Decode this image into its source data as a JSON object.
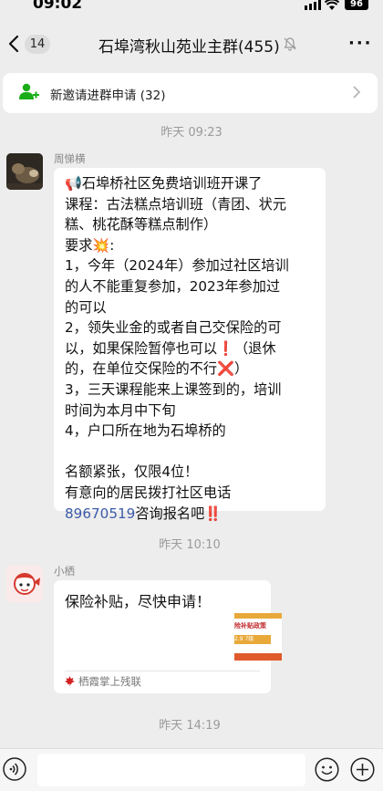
{
  "status_bar": {
    "time": "09:02",
    "battery": "96"
  },
  "nav": {
    "unread_count": "14",
    "title": "石埠湾秋山苑业主群(455)",
    "more_label": "···"
  },
  "invite_banner": {
    "text": "新邀请进群申请 (32)"
  },
  "messages": [
    {
      "timestamp": "昨天 09:23",
      "sender": "周悌横",
      "lines": [
        "📢石埠桥社区免费培训班开课了",
        "课程：古法糕点培训班（青团、状元",
        "糕、桃花酥等糕点制作）",
        "要求💥:",
        "1，今年（2024年）参加过社区培训",
        "的人不能重复参加，2023年参加过",
        "的可以",
        "2，领失业金的或者自己交保险的可",
        "以，如果保险暂停也可以❗（退休",
        "的，在单位交保险的不行❌）",
        "3，三天课程能来上课签到的，培训",
        "时间为本月中下旬",
        "4，户口所在地为石埠桥的",
        "",
        "名额紧张，仅限4位！",
        "有意向的居民拨打社区电话"
      ],
      "phone": "89670519",
      "last_line_suffix": "咨询报名吧‼️"
    },
    {
      "timestamp": "昨天 10:10",
      "sender": "小栖",
      "card_title": "保险补贴，尽快申请！",
      "card_thumb_text": "险补贴政策",
      "card_thumb_sub": "2.9 7级",
      "card_source": "栖霞掌上残联"
    }
  ],
  "last_timestamp": "昨天 14:19"
}
